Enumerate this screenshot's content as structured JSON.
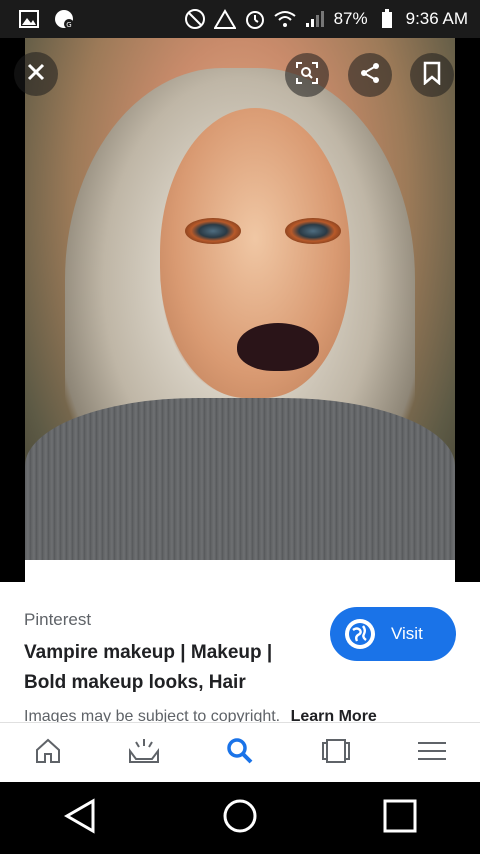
{
  "status_bar": {
    "battery": "87%",
    "time": "9:36 AM",
    "icons": [
      "gallery-icon",
      "notification-icon",
      "do-not-disturb-icon",
      "warning-icon",
      "alarm-icon",
      "wifi-icon",
      "signal-icon",
      "battery-icon"
    ]
  },
  "viewer": {
    "close_icon": "close-icon",
    "actions": [
      "lens-search-icon",
      "share-icon",
      "bookmark-icon"
    ]
  },
  "result": {
    "source": "Pinterest",
    "title": "Vampire makeup | Makeup | Bold makeup looks, Hair",
    "visit_label": "Visit",
    "copyright_text": "Images may be subject to copyright.",
    "learn_more": "Learn More"
  },
  "bottom_nav": {
    "items": [
      "home-icon",
      "updates-icon",
      "search-icon",
      "tabs-icon",
      "menu-icon"
    ],
    "active": "search-icon",
    "active_color": "#1a73e8",
    "inactive_color": "#5f6368"
  },
  "system_nav": [
    "back-icon",
    "home-icon",
    "recents-icon"
  ],
  "colors": {
    "accent": "#1a73e8",
    "status_bar": "#1b1b1b"
  }
}
